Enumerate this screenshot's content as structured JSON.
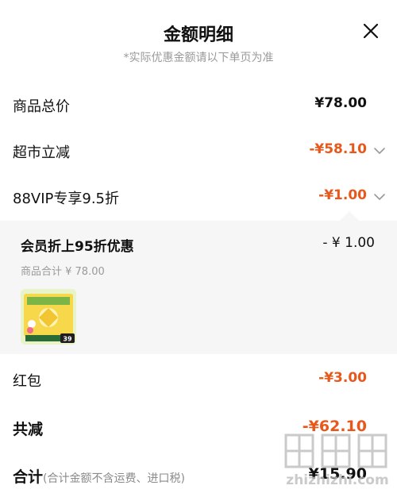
{
  "header": {
    "title": "金额明细",
    "subtitle": "*实际优惠金额请以下单页为准",
    "close_icon": "close-icon"
  },
  "rows": {
    "goods_total": {
      "label": "商品总价",
      "amount": "¥78.00"
    },
    "supermarket": {
      "label": "超市立减",
      "amount": "-¥58.10",
      "icon": "chevron-down-icon"
    },
    "vip": {
      "label": "88VIP专享9.5折",
      "amount": "-¥1.00",
      "icon": "chevron-up-icon"
    }
  },
  "vip_detail": {
    "title": "会员折上95折优惠",
    "amount": "- ¥ 1.00",
    "subtotal": "商品合计 ¥ 78.00",
    "product_badge": "39"
  },
  "red_packet": {
    "label": "红包",
    "amount": "-¥3.00"
  },
  "total_reduce": {
    "label": "共减",
    "amount": "-¥62.10"
  },
  "grand_total": {
    "label": "合计",
    "note": "(合计金额不含运费、进口税)",
    "amount": "¥15.90"
  },
  "watermark": {
    "text": "zhizhizhi.com",
    "logo": "值值值"
  },
  "colors": {
    "accent": "#e8571b",
    "muted": "#9a9a9a",
    "panel": "#f6f6f6"
  }
}
